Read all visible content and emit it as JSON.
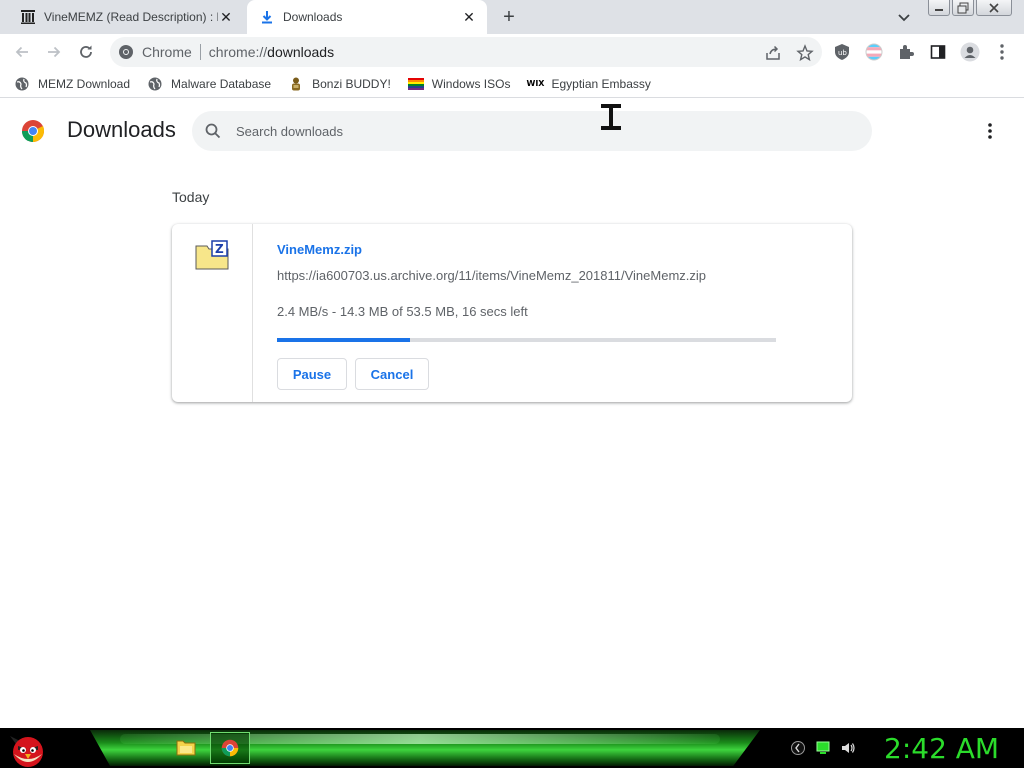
{
  "tabs": [
    {
      "title": "VineMEMZ (Read Description) : F",
      "active": false
    },
    {
      "title": "Downloads",
      "active": true
    }
  ],
  "toolbar": {
    "chip_label": "Chrome",
    "url_scheme": "chrome://",
    "url_host": "downloads"
  },
  "bookmarks": [
    {
      "label": "MEMZ Download",
      "icon": "globe-icon"
    },
    {
      "label": "Malware Database",
      "icon": "globe-icon"
    },
    {
      "label": "Bonzi BUDDY!",
      "icon": "bonzi-icon"
    },
    {
      "label": "Windows ISOs",
      "icon": "rainbow-flag-icon"
    },
    {
      "label": "Egyptian Embassy",
      "icon": "wix-icon",
      "icon_text": "WIX"
    }
  ],
  "page": {
    "title": "Downloads",
    "search_placeholder": "Search downloads",
    "section_label": "Today"
  },
  "download": {
    "file_name": "VineMemz.zip",
    "url": "https://ia600703.us.archive.org/11/items/VineMemz_201811/VineMemz.zip",
    "status": "2.4 MB/s - 14.3 MB of 53.5 MB, 16 secs left",
    "progress_fraction": 0.267,
    "pause_label": "Pause",
    "cancel_label": "Cancel"
  },
  "taskbar": {
    "clock": "2:42 AM"
  },
  "colors": {
    "accent": "#1a73e8",
    "clock": "#2bdc2b"
  }
}
